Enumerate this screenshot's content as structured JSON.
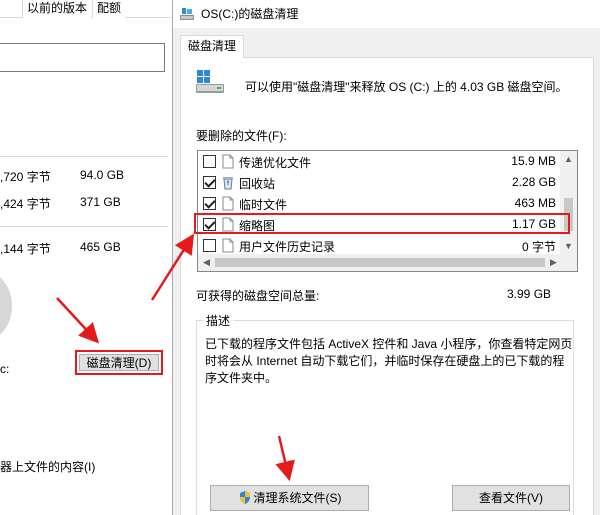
{
  "left_window": {
    "tabs": [
      "以前的版本",
      "配额"
    ],
    "rows": [
      {
        "bytes": ",720 字节",
        "size": "94.0 GB"
      },
      {
        "bytes": ",424 字节",
        "size": "371 GB"
      },
      {
        "bytes": ",144 字节",
        "size": "465 GB"
      }
    ],
    "colon": "c:",
    "cleanup_button": "磁盘清理(D)",
    "compress_text": "器上文件的内容(I)"
  },
  "dialog": {
    "title": "OS(C:)的磁盘清理",
    "tab": "磁盘清理",
    "intro": "可以使用\"磁盘清理\"来释放 OS (C:) 上的 4.03 GB 磁盘空间。",
    "files_label": "要删除的文件(F):",
    "files": [
      {
        "name": "传递优化文件",
        "size": "15.9 MB",
        "checked": false,
        "icon": "file-icon"
      },
      {
        "name": "回收站",
        "size": "2.28 GB",
        "checked": true,
        "icon": "recycle-bin-icon"
      },
      {
        "name": "临时文件",
        "size": "463 MB",
        "checked": true,
        "icon": "file-icon"
      },
      {
        "name": "缩略图",
        "size": "1.17 GB",
        "checked": true,
        "icon": "file-icon"
      },
      {
        "name": "用户文件历史记录",
        "size": "0 字节",
        "checked": false,
        "icon": "file-icon"
      }
    ],
    "gain_label": "可获得的磁盘空间总量:",
    "gain_value": "3.99 GB",
    "description_label": "描述",
    "description": "已下载的程序文件包括 ActiveX 控件和 Java 小程序，你查看特定网页时将会从 Internet 自动下载它们，并临时保存在硬盘上的已下载的程序文件夹中。",
    "clean_system_button": "清理系统文件(S)",
    "view_files_button": "查看文件(V)"
  },
  "colors": {
    "highlight": "#e31b1b",
    "dialog_bg": "#f0f0f0",
    "button_bg": "#e1e1e1"
  }
}
